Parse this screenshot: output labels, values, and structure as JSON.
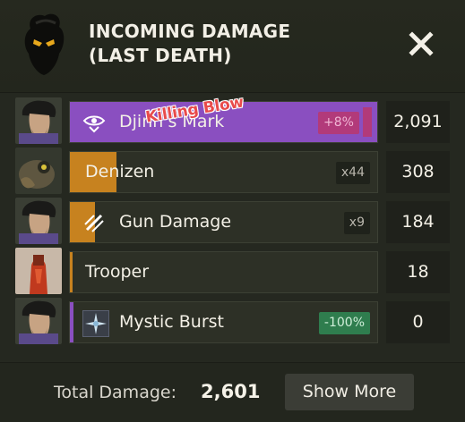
{
  "header": {
    "title_line1": "INCOMING DAMAGE",
    "title_line2": "(LAST DEATH)",
    "close_icon": "close-x-icon"
  },
  "rows": [
    {
      "source": "Djinn's Mark",
      "icon": "eye-sigil-icon",
      "modifier": "+8%",
      "value": "2,091",
      "killing_blow": "Killing Blow",
      "color": "#8a4fc0",
      "avatar": "hero-portrait"
    },
    {
      "source": "Denizen",
      "modifier": "x44",
      "value": "308",
      "color": "#c7821f",
      "avatar": "denizen-portrait"
    },
    {
      "source": "Gun Damage",
      "icon": "gun-claw-icon",
      "modifier": "x9",
      "value": "184",
      "color": "#c7821f",
      "avatar": "hero-portrait"
    },
    {
      "source": "Trooper",
      "modifier": "",
      "value": "18",
      "color": "#c7821f",
      "avatar": "trooper-portrait"
    },
    {
      "source": "Mystic Burst",
      "icon": "mystic-burst-icon",
      "modifier": "-100%",
      "value": "0",
      "color": "#8a4fc0",
      "avatar": "hero-portrait"
    }
  ],
  "footer": {
    "total_label": "Total Damage:",
    "total_value": "2,601",
    "show_more": "Show More"
  },
  "colors": {
    "spirit": "#8a4fc0",
    "weapon": "#c7821f",
    "kill": "#e84a4a"
  }
}
